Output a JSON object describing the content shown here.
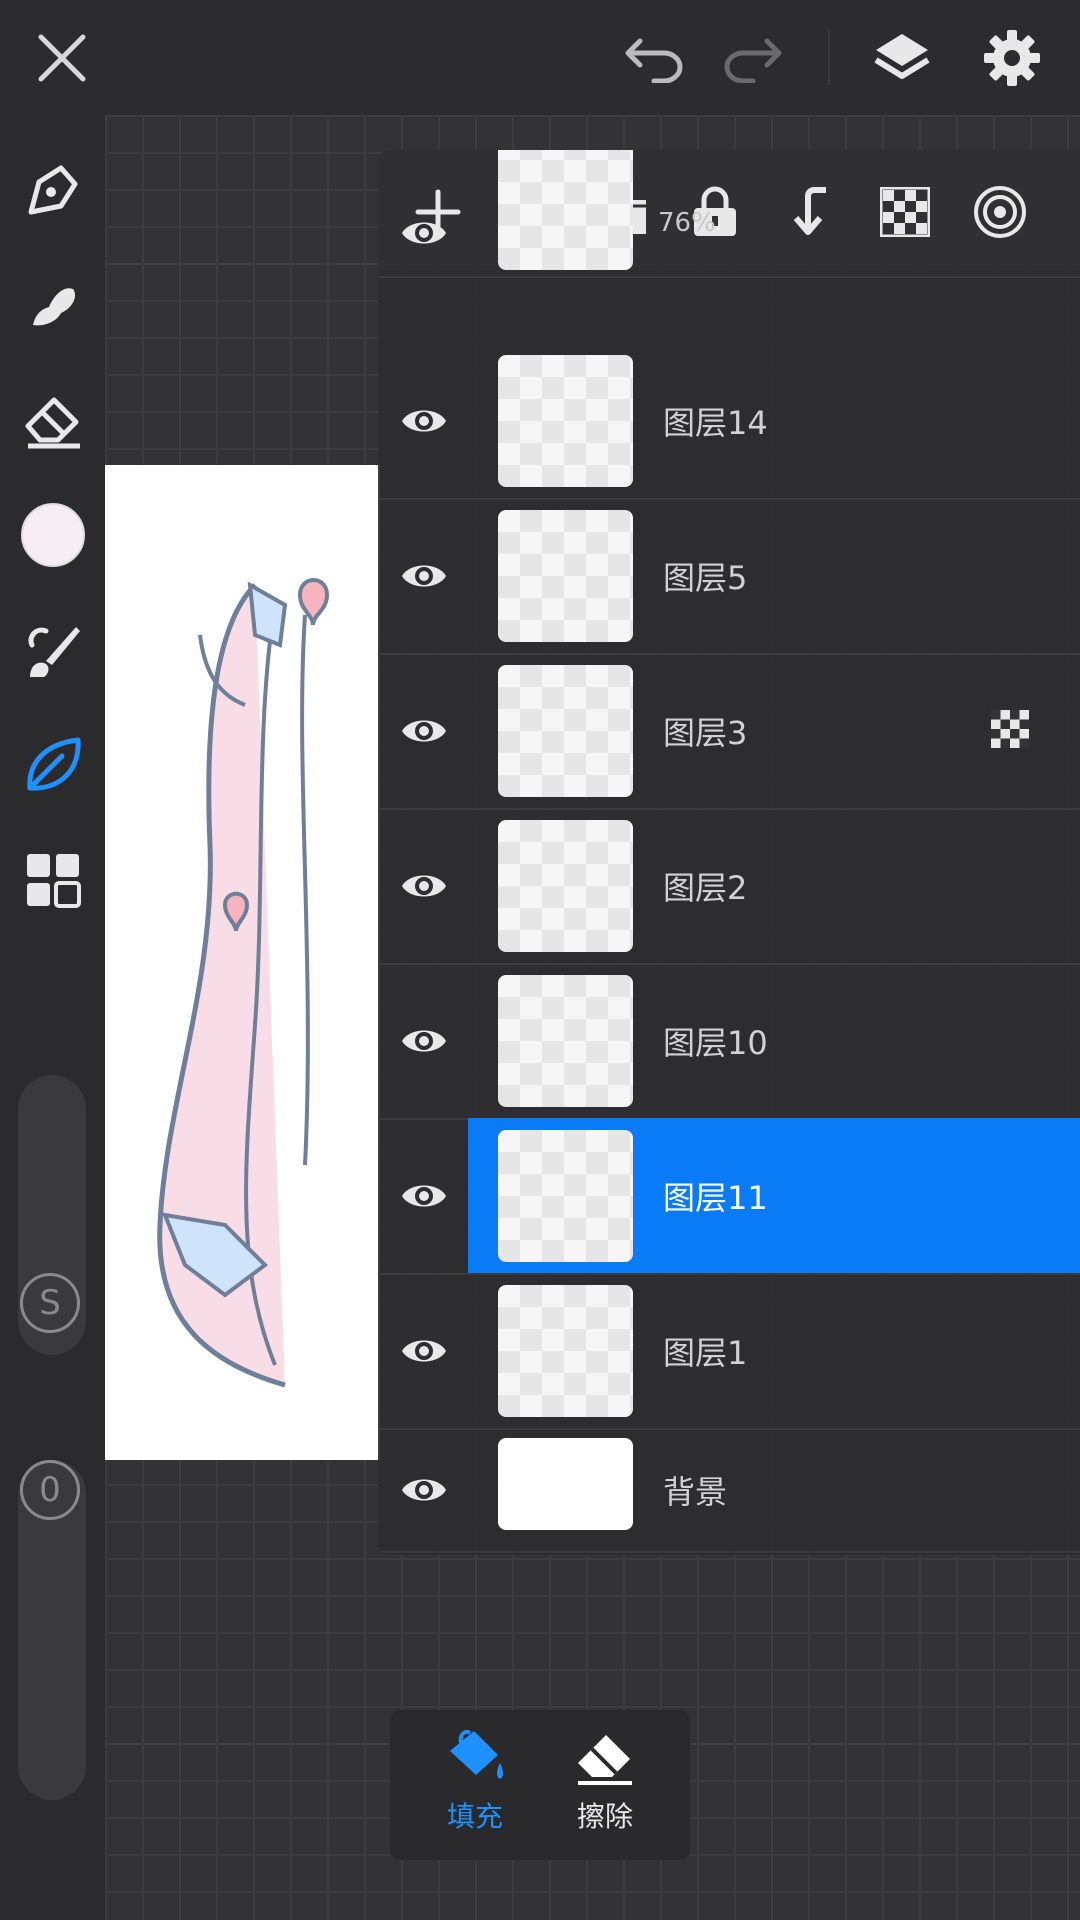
{
  "layers_panel": {
    "layers": [
      {
        "name": "",
        "sub": "76%",
        "thumb": "checker"
      },
      {
        "name": "图层14",
        "sub": "",
        "thumb": "checker"
      },
      {
        "name": "图层5",
        "sub": "",
        "thumb": "checker"
      },
      {
        "name": "图层3",
        "sub": "",
        "thumb": "checker",
        "mode": "checker-mode-icon"
      },
      {
        "name": "图层2",
        "sub": "",
        "thumb": "checker"
      },
      {
        "name": "图层10",
        "sub": "",
        "thumb": "checker"
      },
      {
        "name": "图层11",
        "sub": "",
        "thumb": "checker",
        "selected": true
      },
      {
        "name": "图层1",
        "sub": "",
        "thumb": "checker"
      },
      {
        "name": "背景",
        "sub": "",
        "thumb": "white"
      }
    ]
  },
  "fill_popup": {
    "fill_label": "填充",
    "erase_label": "擦除"
  },
  "sliders": {
    "size_label": "S",
    "opacity_label": "0"
  },
  "colors": {
    "accent": "#0a7bf6",
    "current_color": "#f7eef4"
  }
}
